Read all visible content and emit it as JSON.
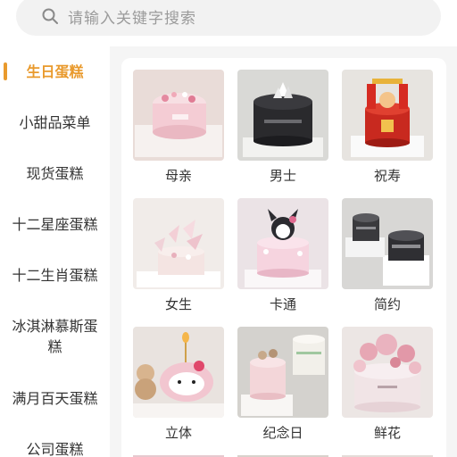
{
  "search": {
    "placeholder": "请输入关键字搜索",
    "icon": "search-icon"
  },
  "sidebar": {
    "items": [
      {
        "label": "生日蛋糕",
        "active": true
      },
      {
        "label": "小甜品菜单"
      },
      {
        "label": "现货蛋糕"
      },
      {
        "label": "十二星座蛋糕"
      },
      {
        "label": "十二生肖蛋糕"
      },
      {
        "label": "冰淇淋慕斯蛋糕"
      },
      {
        "label": "满月百天蛋糕"
      },
      {
        "label": "公司蛋糕"
      }
    ]
  },
  "categories": [
    {
      "label": "母亲"
    },
    {
      "label": "男士"
    },
    {
      "label": "祝寿"
    },
    {
      "label": "女生"
    },
    {
      "label": "卡通"
    },
    {
      "label": "简约"
    },
    {
      "label": "立体"
    },
    {
      "label": "纪念日"
    },
    {
      "label": "鲜花"
    }
  ],
  "colors": {
    "accent": "#e99a2d",
    "text": "#333333",
    "placeholder": "#9b9b9b",
    "content_bg": "#f5f5f5"
  }
}
